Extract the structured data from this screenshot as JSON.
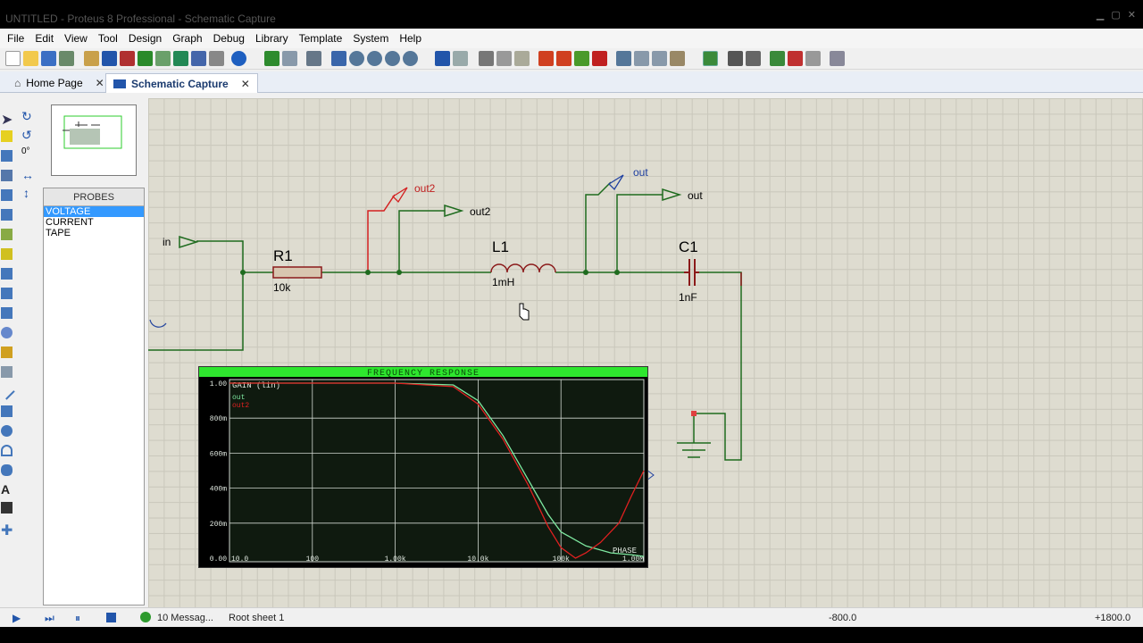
{
  "window": {
    "title": "UNTITLED - Proteus 8 Professional - Schematic Capture"
  },
  "menu": [
    "File",
    "Edit",
    "View",
    "Tool",
    "Design",
    "Graph",
    "Debug",
    "Library",
    "Template",
    "System",
    "Help"
  ],
  "tabs": [
    {
      "label": "Home Page",
      "icon": "home-icon"
    },
    {
      "label": "Schematic Capture",
      "icon": "schematic-icon",
      "active": true
    }
  ],
  "rotation": {
    "angle": "0°"
  },
  "probes": {
    "header": "PROBES",
    "items": [
      "VOLTAGE",
      "CURRENT",
      "TAPE"
    ],
    "selected": "VOLTAGE"
  },
  "schematic": {
    "terminal_in": "in",
    "r1": {
      "name": "R1",
      "value": "10k"
    },
    "l1": {
      "name": "L1",
      "value": "1mH"
    },
    "c1": {
      "name": "C1",
      "value": "1nF"
    },
    "probe_out2": "out2",
    "terminal_out2": "out2",
    "probe_out": "out",
    "terminal_out": "out"
  },
  "graph": {
    "title": "FREQUENCY RESPONSE",
    "axis_label": "GAIN (lin)",
    "legend": [
      "out",
      "out2"
    ],
    "right_label": "PHASE",
    "y_ticks": [
      "1.00",
      "800m",
      "600m",
      "400m",
      "200m",
      "0.00"
    ],
    "x_ticks": [
      "10.0",
      "100",
      "1.00k",
      "10.0k",
      "100k",
      "1.00M"
    ]
  },
  "status": {
    "messages": "10 Messag...",
    "sheet": "Root sheet 1",
    "x": "-800.0",
    "y": "+1800.0"
  },
  "colors": {
    "wire": "#1e6b1e",
    "component": "#8b1a1a",
    "graph_bg": "#0f1a0f",
    "graph_header": "#2ee62e",
    "trace_out": "#7ee8a0",
    "trace_out2": "#e02020",
    "probe_out2": "#d42020",
    "probe_out": "#2040a0"
  },
  "chart_data": {
    "type": "line",
    "title": "FREQUENCY RESPONSE",
    "xlabel": "",
    "ylabel": "GAIN (lin)",
    "x_scale": "log",
    "xlim": [
      10,
      1000000
    ],
    "ylim": [
      0,
      1
    ],
    "series": [
      {
        "name": "out",
        "x": [
          10,
          100,
          1000,
          5000,
          10000,
          20000,
          40000,
          70000,
          100000,
          200000,
          400000,
          700000,
          1000000
        ],
        "values": [
          1.0,
          1.0,
          1.0,
          0.99,
          0.9,
          0.7,
          0.45,
          0.25,
          0.15,
          0.07,
          0.03,
          0.02,
          0.01
        ]
      },
      {
        "name": "out2",
        "x": [
          10,
          100,
          1000,
          5000,
          10000,
          20000,
          40000,
          70000,
          100000,
          150000,
          200000,
          300000,
          500000,
          700000,
          1000000
        ],
        "values": [
          1.0,
          1.0,
          1.0,
          0.98,
          0.88,
          0.68,
          0.42,
          0.18,
          0.06,
          0.0,
          0.03,
          0.09,
          0.2,
          0.35,
          0.5
        ]
      }
    ]
  }
}
